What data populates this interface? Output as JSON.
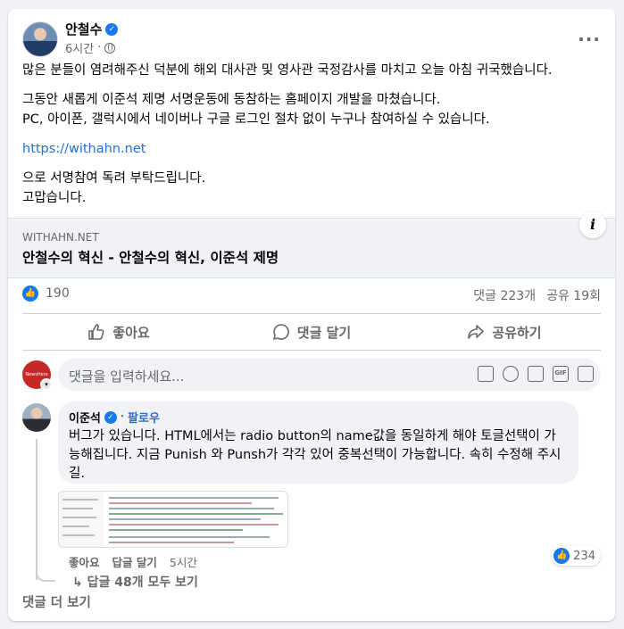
{
  "post": {
    "author": "안철수",
    "time": "6시간",
    "more_label": "···",
    "paragraphs": [
      "많은 분들이 염려해주신 덕분에 해외 대사관 및 영사관 국정감사를 마치고 오늘 아침 귀국했습니다.",
      "그동안 새롭게 이준석 제명 서명운동에 동참하는 홈페이지 개발을 마쳤습니다.\nPC, 아이폰, 갤럭시에서 네이버나 구글 로그인 절차 없이 누구나 참여하실 수 있습니다.",
      "https://withahn.net",
      "으로 서명참여 독려 부탁드립니다.\n고맙습니다."
    ],
    "link_preview": {
      "domain": "WITHAHN.NET",
      "title": "안철수의 혁신 - 안철수의 혁신, 이준석 제명",
      "info_label": "i"
    },
    "stats": {
      "likes": "190",
      "comments": "댓글 223개",
      "shares": "공유 19회"
    },
    "actions": {
      "like": "좋아요",
      "comment": "댓글 달기",
      "share": "공유하기"
    }
  },
  "composer": {
    "placeholder": "댓글을 입력하세요...",
    "avatar_text": "NewsHere",
    "gif_label": "GIF"
  },
  "comment": {
    "author": "이준석",
    "follow": "팔로우",
    "text": "버그가 있습니다. HTML에서는 radio button의 name값을 동일하게 해야 토글선택이 가능해집니다. 지금 Punish 와 Punsh가 각각 있어 중복선택이 가능합니다. 속히 수정해 주시길.",
    "like_label": "좋아요",
    "reply_label": "답글 달기",
    "time": "5시간",
    "reactions": "234",
    "replies_label": "답글 48개 모두 보기"
  },
  "more_comments_label": "댓글 더 보기",
  "colors": {
    "accent": "#1877f2",
    "link": "#216fdb",
    "muted": "#65676b",
    "background": "#f0f2f5"
  }
}
